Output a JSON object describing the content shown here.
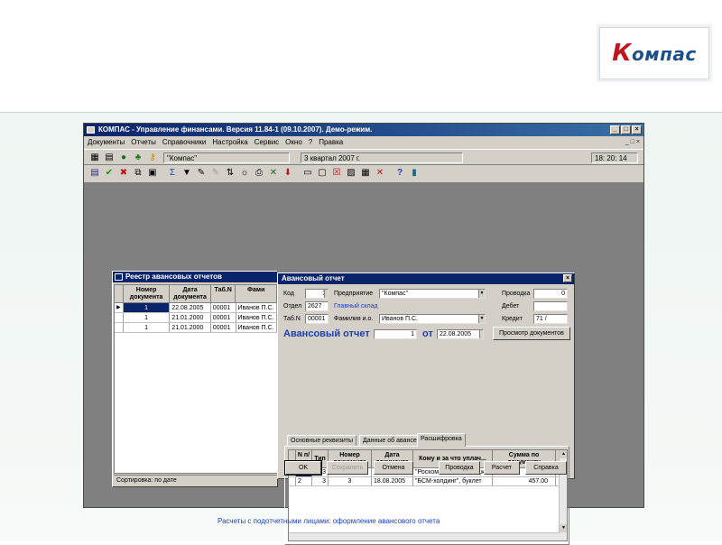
{
  "colors": {
    "accent_blue": "#1a3fbf",
    "title_bar": "#0a246a",
    "window_face": "#d4d0c8"
  },
  "logo": {
    "text_k": "К",
    "text_rest": "омпас"
  },
  "app": {
    "title": "КОМПАС - Управление финансами. Версия 11.84-1 (09.10.2007). Демо-режим.",
    "menu": [
      "Документы",
      "Отчеты",
      "Справочники",
      "Настройка",
      "Сервис",
      "Окно",
      "?",
      "Правка"
    ],
    "mdi_buttons": "_ □ ×",
    "org_field": "\"Компас\"",
    "period_field": "3 квартал 2007 г.",
    "time": "18: 20: 14"
  },
  "registry": {
    "title": "Реестр авансовых отчетов",
    "columns": [
      "Номер документа",
      "Дата документа",
      "Таб.N",
      "Фами"
    ],
    "rows": [
      {
        "num": "1",
        "date": "22.08.2005",
        "tab": "00001",
        "name": "Иванов П.С."
      },
      {
        "num": "1",
        "date": "21.01.2000",
        "tab": "00001",
        "name": "Иванов П.С."
      },
      {
        "num": "1",
        "date": "21.01.2000",
        "tab": "00001",
        "name": "Иванов П.С."
      }
    ],
    "status": "Сортировка: по дате"
  },
  "dialog": {
    "title": "Авансовый отчет",
    "code_label": "Код",
    "code_value": "1",
    "enterprise_label": "Предприятие",
    "enterprise_value": "\"Компас\"",
    "posting_label": "Проводка",
    "posting_value": "0",
    "dept_label": "Отдел",
    "dept_value": "2627",
    "dept_name": "Главный склад",
    "debit_label": "Дебет",
    "tab_label": "Таб.N",
    "tab_value": "00001",
    "fio_label": "Фамилия и.о.",
    "fio_value": "Иванов П.С.",
    "credit_label": "Кредит",
    "credit_value": "71 /",
    "report_label": "Авансовый отчет",
    "report_num": "1",
    "from_label": "от",
    "report_date": "22.08.2005",
    "view_docs_button": "Просмотр документов",
    "tabs": [
      "Основные реквизиты",
      "Данные об авансе",
      "Расшифровка"
    ],
    "grid_columns": [
      "N п/п",
      "Тип",
      "Номер документа",
      "Дата документа",
      "Кому и за что уплач...",
      "Сумма по документу"
    ],
    "grid_rows": [
      {
        "n": "1",
        "type": "3",
        "num": "13",
        "date": "18.08.2005",
        "whom": "\"Роскомплект\", катридж",
        "sum": "2000.00"
      },
      {
        "n": "2",
        "type": "3",
        "num": "3",
        "date": "18.08.2005",
        "whom": "\"БСМ-холдинг\", буклет",
        "sum": "457.00"
      }
    ],
    "buttons": {
      "ok": "OK",
      "save": "Сохранить",
      "cancel": "Отмена",
      "posting": "Проводка",
      "calc": "Расчет",
      "help": "Справка"
    }
  },
  "caption": "Расчеты с подотчетными лицами: оформление авансового отчета"
}
